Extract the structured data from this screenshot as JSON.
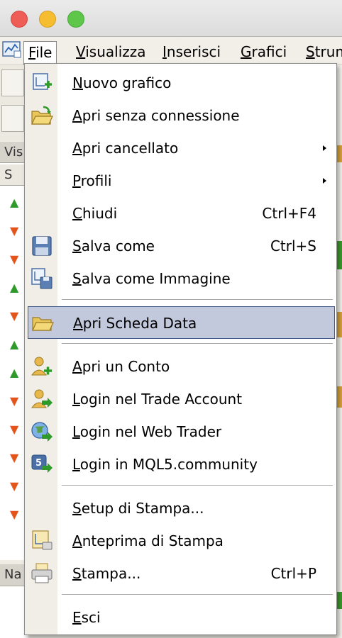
{
  "menubar": {
    "items": [
      "File",
      "Visualizza",
      "Inserisci",
      "Grafici",
      "Strum"
    ]
  },
  "background": {
    "panel_top_label": "Vis",
    "panel_col_label": "S",
    "panel_bottom_label": "Na",
    "arrows": [
      "up",
      "down",
      "down",
      "up",
      "down",
      "up",
      "up",
      "down",
      "down",
      "down",
      "down",
      "down"
    ]
  },
  "file_menu": {
    "items": [
      {
        "label": "Nuovo grafico",
        "shortcut": "",
        "icon": "new-chart-icon"
      },
      {
        "label": "Apri senza connessione",
        "shortcut": "",
        "icon": "open-offline-folder-icon"
      },
      {
        "label": "Apri cancellato",
        "shortcut": "",
        "submenu": true
      },
      {
        "label": "Profili",
        "shortcut": "",
        "submenu": true
      },
      {
        "label": "Chiudi",
        "shortcut": "Ctrl+F4"
      },
      {
        "label": "Salva come",
        "shortcut": "Ctrl+S",
        "icon": "floppy-disk-icon"
      },
      {
        "label": "Salva come Immagine",
        "shortcut": "",
        "icon": "save-image-icon"
      },
      {
        "label": "Apri Scheda Data",
        "shortcut": "",
        "icon": "folder-icon",
        "highlighted": true
      },
      {
        "label": "Apri un Conto",
        "shortcut": "",
        "icon": "user-add-icon"
      },
      {
        "label": "Login nel Trade Account",
        "shortcut": "",
        "icon": "user-login-icon"
      },
      {
        "label": "Login nel Web Trader",
        "shortcut": "",
        "icon": "web-globe-icon"
      },
      {
        "label": "Login in MQL5.community",
        "shortcut": "",
        "icon": "mql5-icon"
      },
      {
        "label": "Setup di Stampa...",
        "shortcut": ""
      },
      {
        "label": "Anteprima di Stampa",
        "shortcut": "",
        "icon": "print-preview-icon"
      },
      {
        "label": "Stampa...",
        "shortcut": "Ctrl+P",
        "icon": "printer-icon"
      },
      {
        "label": "Esci",
        "shortcut": ""
      }
    ]
  },
  "colors": {
    "highlight_bg": "#c2c9dc",
    "highlight_border": "#445c8c",
    "arrow_up": "#2e9a2a",
    "arrow_down": "#e2541b"
  }
}
